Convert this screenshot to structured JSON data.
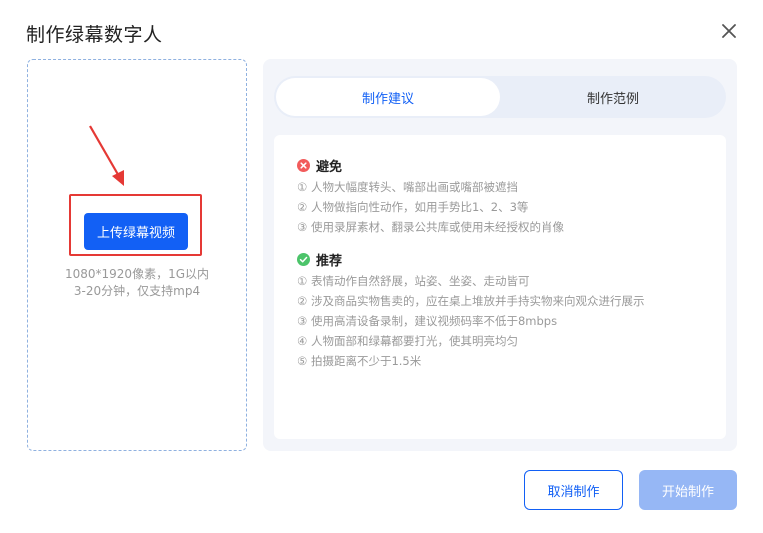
{
  "dialog": {
    "title": "制作绿幕数字人"
  },
  "upload": {
    "button_label": "上传绿幕视频",
    "hint_line1": "1080*1920像素，1G以内",
    "hint_line2": "3-20分钟，仅支持mp4"
  },
  "tabs": [
    {
      "label": "制作建议",
      "active": true
    },
    {
      "label": "制作范例",
      "active": false
    }
  ],
  "avoid": {
    "title": "避免",
    "icon": "error-circle-icon",
    "items": [
      "① 人物大幅度转头、嘴部出画或嘴部被遮挡",
      "② 人物做指向性动作，如用手势比1、2、3等",
      "③ 使用录屏素材、翻录公共库或使用未经授权的肖像"
    ]
  },
  "recommend": {
    "title": "推荐",
    "icon": "check-circle-icon",
    "items": [
      "① 表情动作自然舒展，站姿、坐姿、走动皆可",
      "② 涉及商品实物售卖的，应在桌上堆放并手持实物来向观众进行展示",
      "③ 使用高清设备录制，建议视频码率不低于8mbps",
      "④ 人物面部和绿幕都要打光，使其明亮均匀",
      "⑤ 拍摄距离不少于1.5米"
    ]
  },
  "footer": {
    "cancel_label": "取消制作",
    "start_label": "开始制作"
  },
  "colors": {
    "primary": "#1260f5",
    "primary_disabled": "#96b7f5",
    "annotation_red": "#e53935",
    "error": "#f25c5c",
    "success": "#4cc46a"
  }
}
